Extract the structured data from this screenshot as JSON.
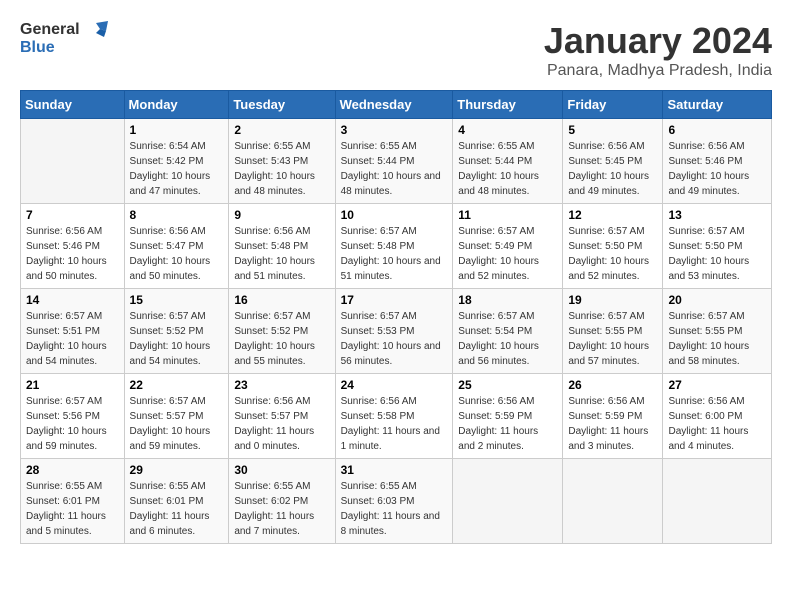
{
  "logo": {
    "line1": "General",
    "line2": "Blue"
  },
  "title": "January 2024",
  "location": "Panara, Madhya Pradesh, India",
  "weekdays": [
    "Sunday",
    "Monday",
    "Tuesday",
    "Wednesday",
    "Thursday",
    "Friday",
    "Saturday"
  ],
  "weeks": [
    [
      {
        "day": "",
        "sunrise": "",
        "sunset": "",
        "daylight": ""
      },
      {
        "day": "1",
        "sunrise": "Sunrise: 6:54 AM",
        "sunset": "Sunset: 5:42 PM",
        "daylight": "Daylight: 10 hours and 47 minutes."
      },
      {
        "day": "2",
        "sunrise": "Sunrise: 6:55 AM",
        "sunset": "Sunset: 5:43 PM",
        "daylight": "Daylight: 10 hours and 48 minutes."
      },
      {
        "day": "3",
        "sunrise": "Sunrise: 6:55 AM",
        "sunset": "Sunset: 5:44 PM",
        "daylight": "Daylight: 10 hours and 48 minutes."
      },
      {
        "day": "4",
        "sunrise": "Sunrise: 6:55 AM",
        "sunset": "Sunset: 5:44 PM",
        "daylight": "Daylight: 10 hours and 48 minutes."
      },
      {
        "day": "5",
        "sunrise": "Sunrise: 6:56 AM",
        "sunset": "Sunset: 5:45 PM",
        "daylight": "Daylight: 10 hours and 49 minutes."
      },
      {
        "day": "6",
        "sunrise": "Sunrise: 6:56 AM",
        "sunset": "Sunset: 5:46 PM",
        "daylight": "Daylight: 10 hours and 49 minutes."
      }
    ],
    [
      {
        "day": "7",
        "sunrise": "Sunrise: 6:56 AM",
        "sunset": "Sunset: 5:46 PM",
        "daylight": "Daylight: 10 hours and 50 minutes."
      },
      {
        "day": "8",
        "sunrise": "Sunrise: 6:56 AM",
        "sunset": "Sunset: 5:47 PM",
        "daylight": "Daylight: 10 hours and 50 minutes."
      },
      {
        "day": "9",
        "sunrise": "Sunrise: 6:56 AM",
        "sunset": "Sunset: 5:48 PM",
        "daylight": "Daylight: 10 hours and 51 minutes."
      },
      {
        "day": "10",
        "sunrise": "Sunrise: 6:57 AM",
        "sunset": "Sunset: 5:48 PM",
        "daylight": "Daylight: 10 hours and 51 minutes."
      },
      {
        "day": "11",
        "sunrise": "Sunrise: 6:57 AM",
        "sunset": "Sunset: 5:49 PM",
        "daylight": "Daylight: 10 hours and 52 minutes."
      },
      {
        "day": "12",
        "sunrise": "Sunrise: 6:57 AM",
        "sunset": "Sunset: 5:50 PM",
        "daylight": "Daylight: 10 hours and 52 minutes."
      },
      {
        "day": "13",
        "sunrise": "Sunrise: 6:57 AM",
        "sunset": "Sunset: 5:50 PM",
        "daylight": "Daylight: 10 hours and 53 minutes."
      }
    ],
    [
      {
        "day": "14",
        "sunrise": "Sunrise: 6:57 AM",
        "sunset": "Sunset: 5:51 PM",
        "daylight": "Daylight: 10 hours and 54 minutes."
      },
      {
        "day": "15",
        "sunrise": "Sunrise: 6:57 AM",
        "sunset": "Sunset: 5:52 PM",
        "daylight": "Daylight: 10 hours and 54 minutes."
      },
      {
        "day": "16",
        "sunrise": "Sunrise: 6:57 AM",
        "sunset": "Sunset: 5:52 PM",
        "daylight": "Daylight: 10 hours and 55 minutes."
      },
      {
        "day": "17",
        "sunrise": "Sunrise: 6:57 AM",
        "sunset": "Sunset: 5:53 PM",
        "daylight": "Daylight: 10 hours and 56 minutes."
      },
      {
        "day": "18",
        "sunrise": "Sunrise: 6:57 AM",
        "sunset": "Sunset: 5:54 PM",
        "daylight": "Daylight: 10 hours and 56 minutes."
      },
      {
        "day": "19",
        "sunrise": "Sunrise: 6:57 AM",
        "sunset": "Sunset: 5:55 PM",
        "daylight": "Daylight: 10 hours and 57 minutes."
      },
      {
        "day": "20",
        "sunrise": "Sunrise: 6:57 AM",
        "sunset": "Sunset: 5:55 PM",
        "daylight": "Daylight: 10 hours and 58 minutes."
      }
    ],
    [
      {
        "day": "21",
        "sunrise": "Sunrise: 6:57 AM",
        "sunset": "Sunset: 5:56 PM",
        "daylight": "Daylight: 10 hours and 59 minutes."
      },
      {
        "day": "22",
        "sunrise": "Sunrise: 6:57 AM",
        "sunset": "Sunset: 5:57 PM",
        "daylight": "Daylight: 10 hours and 59 minutes."
      },
      {
        "day": "23",
        "sunrise": "Sunrise: 6:56 AM",
        "sunset": "Sunset: 5:57 PM",
        "daylight": "Daylight: 11 hours and 0 minutes."
      },
      {
        "day": "24",
        "sunrise": "Sunrise: 6:56 AM",
        "sunset": "Sunset: 5:58 PM",
        "daylight": "Daylight: 11 hours and 1 minute."
      },
      {
        "day": "25",
        "sunrise": "Sunrise: 6:56 AM",
        "sunset": "Sunset: 5:59 PM",
        "daylight": "Daylight: 11 hours and 2 minutes."
      },
      {
        "day": "26",
        "sunrise": "Sunrise: 6:56 AM",
        "sunset": "Sunset: 5:59 PM",
        "daylight": "Daylight: 11 hours and 3 minutes."
      },
      {
        "day": "27",
        "sunrise": "Sunrise: 6:56 AM",
        "sunset": "Sunset: 6:00 PM",
        "daylight": "Daylight: 11 hours and 4 minutes."
      }
    ],
    [
      {
        "day": "28",
        "sunrise": "Sunrise: 6:55 AM",
        "sunset": "Sunset: 6:01 PM",
        "daylight": "Daylight: 11 hours and 5 minutes."
      },
      {
        "day": "29",
        "sunrise": "Sunrise: 6:55 AM",
        "sunset": "Sunset: 6:01 PM",
        "daylight": "Daylight: 11 hours and 6 minutes."
      },
      {
        "day": "30",
        "sunrise": "Sunrise: 6:55 AM",
        "sunset": "Sunset: 6:02 PM",
        "daylight": "Daylight: 11 hours and 7 minutes."
      },
      {
        "day": "31",
        "sunrise": "Sunrise: 6:55 AM",
        "sunset": "Sunset: 6:03 PM",
        "daylight": "Daylight: 11 hours and 8 minutes."
      },
      {
        "day": "",
        "sunrise": "",
        "sunset": "",
        "daylight": ""
      },
      {
        "day": "",
        "sunrise": "",
        "sunset": "",
        "daylight": ""
      },
      {
        "day": "",
        "sunrise": "",
        "sunset": "",
        "daylight": ""
      }
    ]
  ]
}
